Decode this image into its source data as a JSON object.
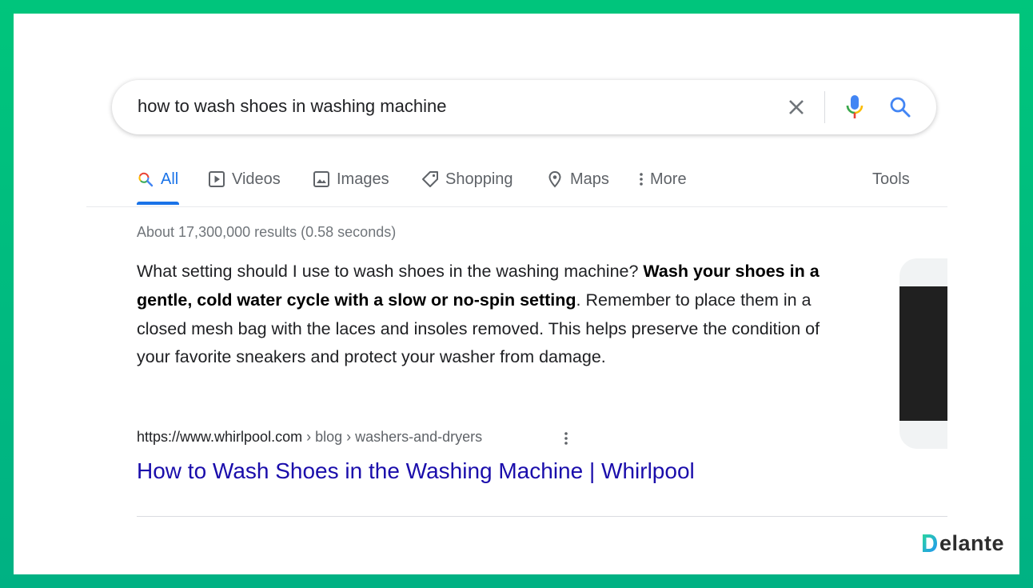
{
  "search": {
    "query": "how to wash shoes in washing machine"
  },
  "tabs": [
    {
      "label": "All",
      "icon": "search-icon",
      "active": true
    },
    {
      "label": "Videos",
      "icon": "video-icon"
    },
    {
      "label": "Images",
      "icon": "image-icon"
    },
    {
      "label": "Shopping",
      "icon": "tag-icon"
    },
    {
      "label": "Maps",
      "icon": "map-pin-icon"
    },
    {
      "label": "More",
      "icon": "more-vert-icon"
    }
  ],
  "tools_label": "Tools",
  "result_stats": "About 17,300,000 results (0.58 seconds)",
  "featured_snippet": {
    "question": "What setting should I use to wash shoes in the washing machine?",
    "bold_answer": "Wash your shoes in a gentle, cold water cycle with a slow or no-spin setting",
    "rest": ". Remember to place them in a closed mesh bag with the laces and insoles removed. This helps preserve the condition of your favorite sneakers and protect your washer from damage."
  },
  "source": {
    "domain": "https://www.whirlpool.com",
    "path": " › blog › washers-and-dryers",
    "title": "How to Wash Shoes in the Washing Machine | Whirlpool"
  },
  "branding": {
    "logo_text": "elante",
    "logo_letter": "D"
  },
  "colors": {
    "frame": "#00c27a",
    "link": "#1a0dab",
    "active_tab": "#1a73e8"
  }
}
